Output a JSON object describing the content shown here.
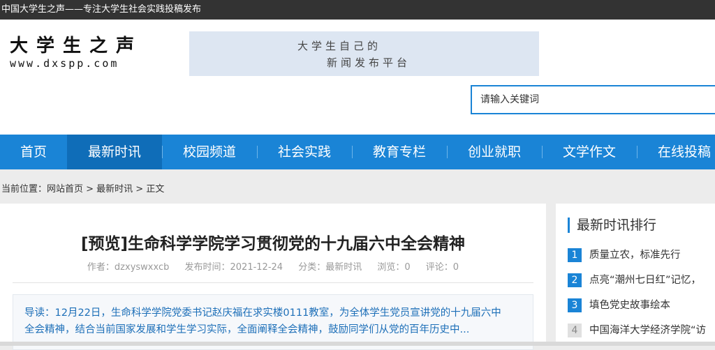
{
  "topbar": {
    "text": "中国大学生之声——专注大学生社会实践投稿发布"
  },
  "logo": {
    "cn": "大学生之声",
    "en": "www.dxspp.com"
  },
  "banner": {
    "line1": "大学生自己的",
    "line2": "新闻发布平台"
  },
  "search": {
    "placeholder": "请输入关键词"
  },
  "nav": {
    "items": [
      "首页",
      "最新时讯",
      "校园频道",
      "社会实践",
      "教育专栏",
      "创业就职",
      "文学作文",
      "在线投稿"
    ],
    "active": "最新时讯"
  },
  "breadcrumb": {
    "text": "当前位置：网站首页 > 最新时讯 > 正文"
  },
  "article": {
    "title": "[预览]生命科学学院学习贯彻党的十九届六中全会精神",
    "author": "作者：dzxyswxxcb",
    "date": "发布时间：2021-12-24",
    "category": "分类：最新时讯",
    "views": "浏览：0",
    "comments": "评论：0",
    "summary_line1": "导读：12月22日，生命科学学院党委书记赵庆福在求实楼0111教室，为全体学生党员宣讲党的十九届六中",
    "summary_line2": "全会精神，结合当前国家发展和学生学习实际，全面阐释全会精神，鼓励同学们从党的百年历史中..."
  },
  "sidebar": {
    "title": "最新时讯排行",
    "items": [
      {
        "num": "1",
        "text": "质量立农，标准先行"
      },
      {
        "num": "2",
        "text": "点亮“潮州七日红”记忆，"
      },
      {
        "num": "3",
        "text": "填色党史故事绘本"
      },
      {
        "num": "4",
        "text": "中国海洋大学经济学院“访"
      }
    ]
  },
  "colors": {
    "accent": "#1a84d6",
    "nav_active": "#0f6db8",
    "topbar": "#333333"
  }
}
